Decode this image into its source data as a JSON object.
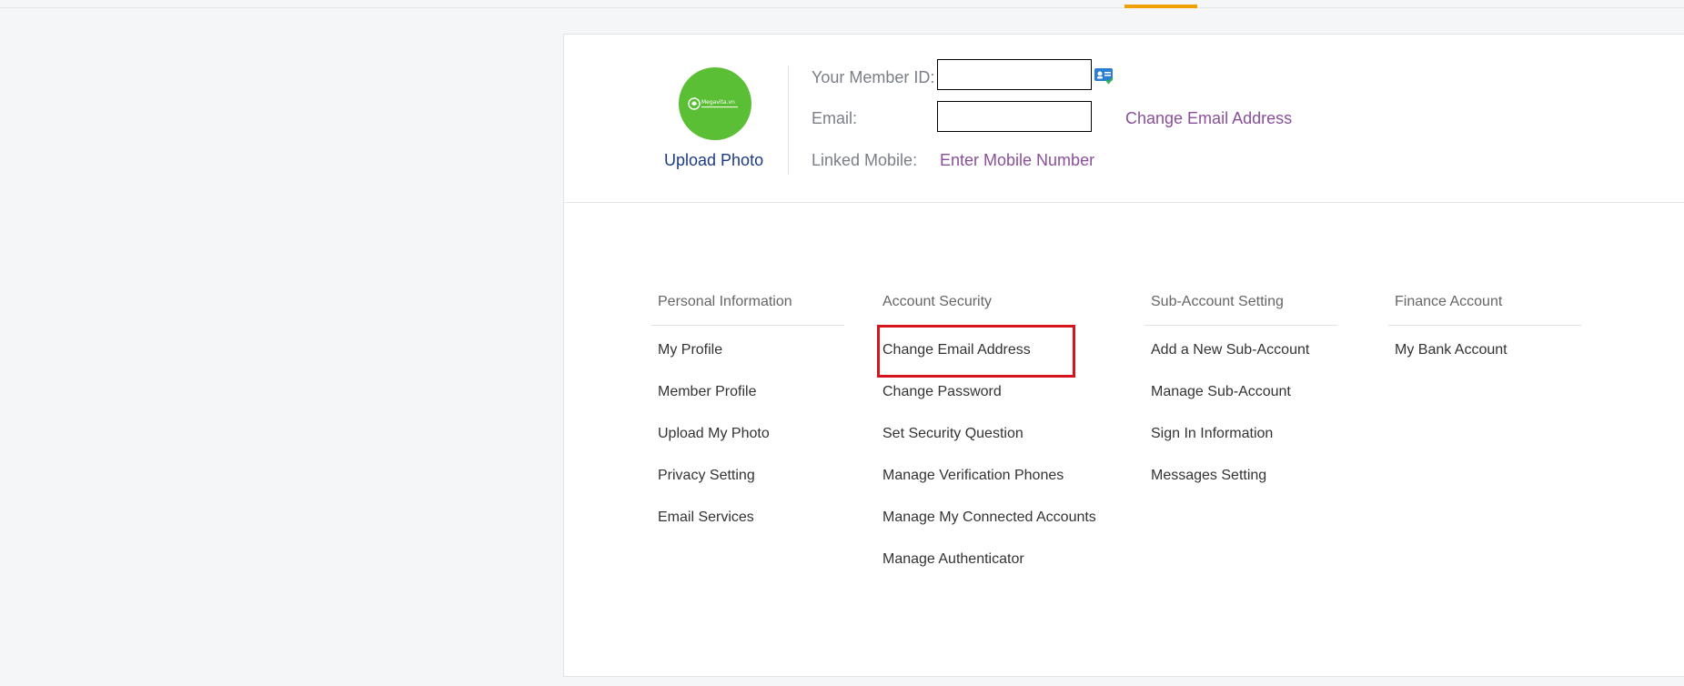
{
  "profile": {
    "avatar_logo_text": "Megavita.vn",
    "upload_photo": "Upload Photo",
    "member_id_label": "Your Member ID:",
    "member_id_value": "",
    "email_label": "Email:",
    "email_value": "",
    "change_email_link": "Change Email Address",
    "linked_mobile_label": "Linked Mobile:",
    "enter_mobile_link": "Enter Mobile Number"
  },
  "colors": {
    "accent_orange": "#f0a000",
    "link_purple": "#8a4f9a",
    "link_blue": "#1d3b84",
    "avatar_green": "#5bbf36",
    "highlight_red": "#d6141c"
  },
  "menu": {
    "personal": {
      "heading": "Personal Information",
      "items": [
        "My Profile",
        "Member Profile",
        "Upload My Photo",
        "Privacy Setting",
        "Email Services"
      ]
    },
    "security": {
      "heading": "Account Security",
      "items": [
        "Change Email Address",
        "Change Password",
        "Set Security Question",
        "Manage Verification Phones",
        "Manage My Connected Accounts",
        "Manage Authenticator"
      ]
    },
    "subaccount": {
      "heading": "Sub-Account Setting",
      "items": [
        "Add a New Sub-Account",
        "Manage Sub-Account",
        "Sign In Information",
        "Messages Setting"
      ]
    },
    "finance": {
      "heading": "Finance Account",
      "items": [
        "My Bank Account"
      ]
    }
  },
  "icons": {
    "id_card": "id-card-icon"
  }
}
